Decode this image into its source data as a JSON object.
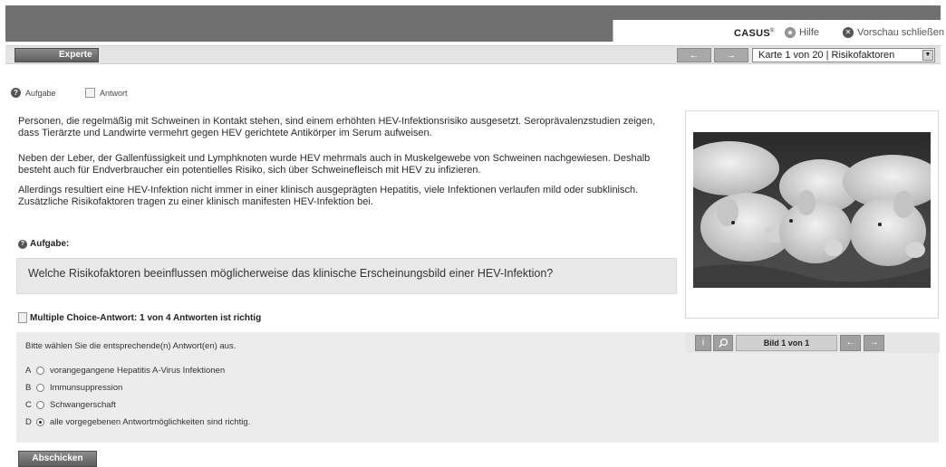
{
  "header": {
    "logo_text": "CASUS",
    "logo_mark": "®",
    "help_label": "Hilfe",
    "close_preview_label": "Vorschau schließen"
  },
  "toolbar": {
    "expert_button": "Experte",
    "prev_arrow": "←",
    "next_arrow": "→",
    "card_select_value": "Karte 1 von 20 | Risikofaktoren"
  },
  "tabs": {
    "aufgabe": "Aufgabe",
    "antwort": "Antwort"
  },
  "content": {
    "para1": "Personen, die regelmäßig mit Schweinen in Kontakt stehen, sind einem erhöhten HEV-Infektionsrisiko ausgesetzt. Seroprävalenzstudien zeigen, dass Tierärzte und Landwirte vermehrt gegen HEV gerichtete Antikörper im Serum aufweisen.",
    "para2": "Neben der Leber, der Gallenfüssigkeit und Lymphknoten wurde HEV mehrmals auch in Muskelgewebe von Schweinen nachgewiesen. Deshalb besteht auch für Endverbraucher ein potentielles Risiko, sich über Schweinefleisch mit HEV zu infizieren.",
    "para3": "Allerdings resultiert eine HEV-Infektion nicht immer in einer klinisch ausgeprägten Hepatitis, viele Infektionen verlaufen mild oder subklinisch. Zusätzliche Risikofaktoren tragen zu einer klinisch manifesten HEV-Infektion bei."
  },
  "task": {
    "heading": "Aufgabe:",
    "question": "Welche Risikofaktoren beeinflussen möglicherweise das klinische Erscheinungsbild einer HEV-Infektion?"
  },
  "answer": {
    "heading": "Multiple Choice-Antwort: 1 von 4 Antworten ist richtig",
    "instruction": "Bitte wählen Sie die entsprechende(n) Antwort(en) aus.",
    "options": [
      {
        "letter": "A",
        "text": "vorangegangene Hepatitis A-Virus Infektionen",
        "selected": false
      },
      {
        "letter": "B",
        "text": "Immunsuppression",
        "selected": false
      },
      {
        "letter": "C",
        "text": "Schwangerschaft",
        "selected": false
      },
      {
        "letter": "D",
        "text": "alle vorgegebenen Antwortmöglichkeiten sind richtig.",
        "selected": true
      }
    ],
    "submit_label": "Abschicken"
  },
  "image_panel": {
    "info_button": "i",
    "image_counter": "Bild 1 von 1",
    "prev_arrow": "←",
    "next_arrow": "→"
  }
}
